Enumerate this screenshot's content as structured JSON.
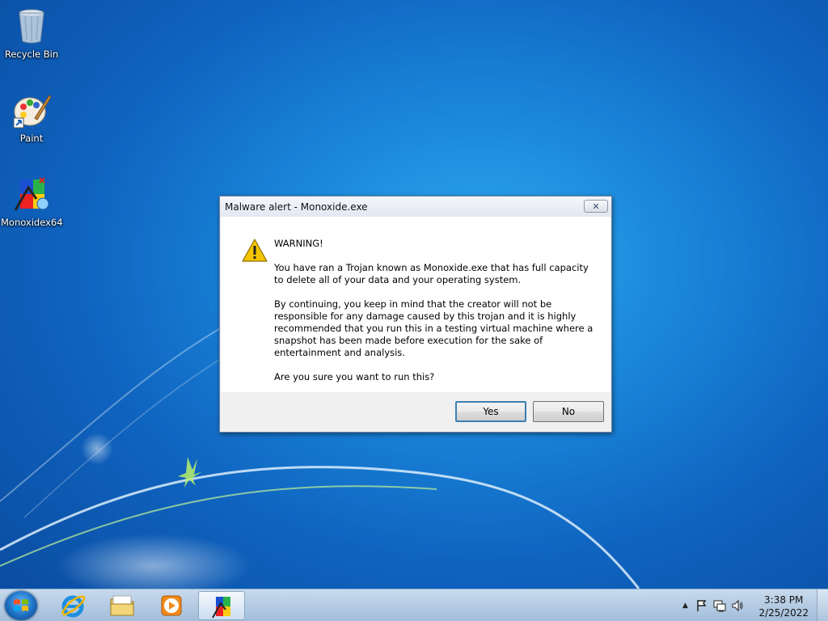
{
  "desktop": {
    "icons": [
      {
        "label": "Recycle Bin",
        "icon": "recycle-bin-icon"
      },
      {
        "label": "Paint",
        "icon": "paint-icon"
      },
      {
        "label": "Monoxidex64",
        "icon": "monoxide-icon"
      }
    ]
  },
  "dialog": {
    "title": "Malware alert - Monoxide.exe",
    "close_glyph": "✕",
    "heading": "WARNING!",
    "paragraph1": "You have ran a Trojan known as Monoxide.exe that has full capacity to delete all of your data and your operating system.",
    "paragraph2": "By continuing, you keep in mind that the creator will not be responsible for any damage caused by this trojan and it is highly recommended that you run this in a testing virtual machine where a snapshot has been made before execution for the sake of entertainment and analysis.",
    "question": "Are you sure you want to run this?",
    "yes_label": "Yes",
    "no_label": "No"
  },
  "taskbar": {
    "items": [
      "start-orb-icon",
      "internet-explorer-icon",
      "file-explorer-icon",
      "media-player-icon",
      "monoxide-icon"
    ],
    "tray": {
      "show_hidden": "▲",
      "clock_time": "3:38 PM",
      "clock_date": "2/25/2022"
    }
  },
  "colors": {
    "wallpaper_blue": "#1a86da",
    "dialog_footer": "#f0f0f0",
    "warning_yellow": "#f5c400"
  }
}
